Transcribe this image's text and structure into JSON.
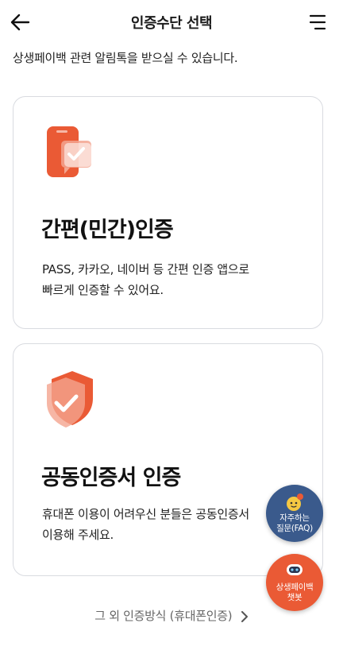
{
  "header": {
    "title": "인증수단 선택",
    "back_icon": "arrow-left-icon",
    "menu_icon": "hamburger-menu-icon"
  },
  "notice": "상생페이백 관련 알림톡을 받으실 수 있습니다.",
  "cards": [
    {
      "icon": "phone-check-icon",
      "title": "간편(민간)인증",
      "description": "PASS, 카카오, 네이버 등 간편 인증 앱으로\n빠르게 인증할 수 있어요."
    },
    {
      "icon": "shield-check-icon",
      "title": "공동인증서 인증",
      "description": "휴대폰 이용이 어려우신 분들은 공동인증서\n이용해 주세요."
    }
  ],
  "other_link": "그 외 인증방식 (휴대폰인증)",
  "fabs": {
    "faq_label": "자주하는\n질문(FAQ)",
    "chatbot_label": "상생페이백\n챗봇"
  },
  "colors": {
    "accent": "#ea5a35",
    "faq_bg": "#3a5a8c",
    "card_border": "#d9dbe0"
  }
}
